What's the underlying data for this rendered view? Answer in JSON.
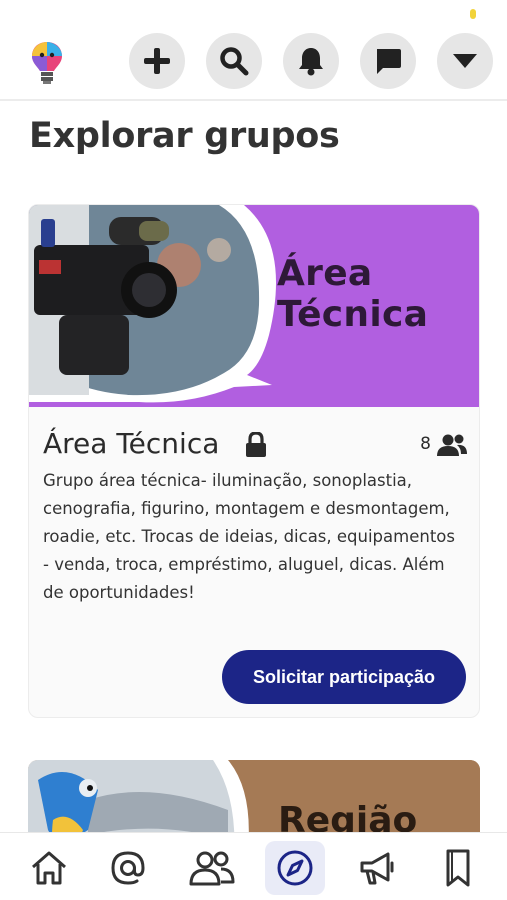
{
  "header": {
    "logo": "lightbulb-logo",
    "buttons": [
      {
        "name": "create-button",
        "icon": "plus-icon"
      },
      {
        "name": "search-button",
        "icon": "search-icon"
      },
      {
        "name": "notifications-button",
        "icon": "bell-icon"
      },
      {
        "name": "messages-button",
        "icon": "chat-icon"
      },
      {
        "name": "menu-button",
        "icon": "caret-down-icon"
      }
    ]
  },
  "page": {
    "title": "Explorar grupos"
  },
  "groups": [
    {
      "banner_title_line1": "Área",
      "banner_title_line2": "Técnica",
      "name": "Área Técnica",
      "privacy_icon": "lock-icon",
      "member_count": "8",
      "description": "Grupo área técnica- iluminação, sonoplastia, cenografia, figurino, montagem e desmontagem, roadie, etc. Trocas de ideias, dicas, equipamentos - venda, troca, empréstimo, aluguel, dicas. Além de oportunidades!",
      "join_label": "Solicitar participação",
      "banner_color": "#b15fe0"
    },
    {
      "banner_title": "Região",
      "banner_color": "#a57a55"
    }
  ],
  "bottom_nav": [
    {
      "name": "nav-home",
      "icon": "home-icon"
    },
    {
      "name": "nav-mentions",
      "icon": "at-icon"
    },
    {
      "name": "nav-people",
      "icon": "people-icon"
    },
    {
      "name": "nav-explore",
      "icon": "compass-icon",
      "active": true
    },
    {
      "name": "nav-announcements",
      "icon": "megaphone-icon"
    },
    {
      "name": "nav-bookmarks",
      "icon": "bookmark-icon"
    }
  ],
  "colors": {
    "primary": "#1c2587",
    "accent_purple": "#b15fe0"
  }
}
